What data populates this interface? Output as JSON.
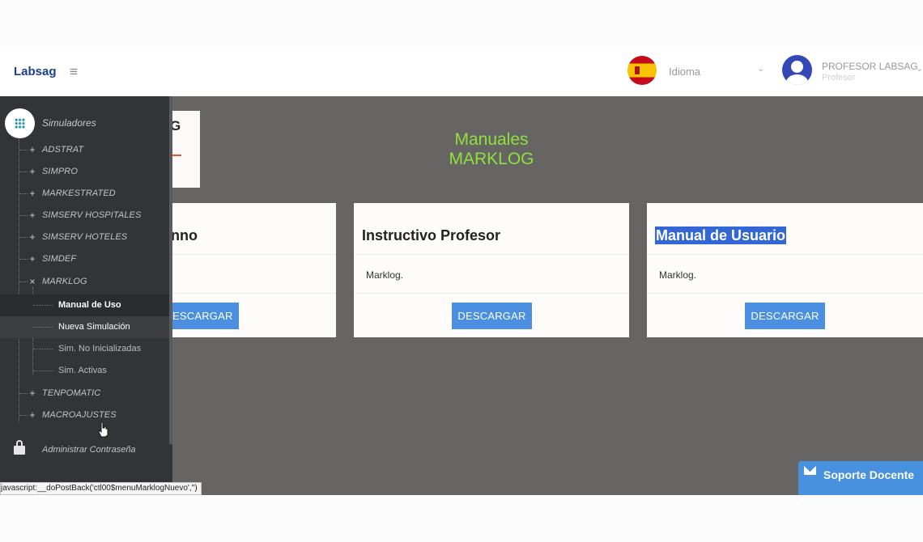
{
  "header": {
    "brand": "Labsag",
    "menu_icon": "hamburger-icon",
    "language_label": "Idioma",
    "user_name": "PROFESOR LABSAG",
    "user_role": "Profesor"
  },
  "sidebar": {
    "root_label": "Simuladores",
    "items": [
      {
        "label": "ADSTRAT",
        "toggle": "+"
      },
      {
        "label": "SIMPRO",
        "toggle": "+"
      },
      {
        "label": "MARKESTRATED",
        "toggle": "+"
      },
      {
        "label": "SIMSERV HOSPITALES",
        "toggle": "+"
      },
      {
        "label": "SIMSERV HOTELES",
        "toggle": "+"
      },
      {
        "label": "SIMDEF",
        "toggle": "+"
      },
      {
        "label": "MARKLOG",
        "toggle": "×"
      },
      {
        "label": "TENPOMATIC",
        "toggle": "+"
      },
      {
        "label": "MACROAJUSTES",
        "toggle": "+"
      }
    ],
    "subitems": [
      {
        "label": "Manual de Uso"
      },
      {
        "label": "Nueva Simulación"
      },
      {
        "label": "Sim. No Inicializadas"
      },
      {
        "label": "Sim. Activas"
      }
    ],
    "password_label": "Administrar Contraseña"
  },
  "main": {
    "logo_text": "G",
    "title_line1": "Manuales",
    "title_line2": "MARKLOG",
    "cards": [
      {
        "title": "nno",
        "text": "",
        "button": "DESCARGAR"
      },
      {
        "title": "Instructivo Profesor",
        "text": "Marklog.",
        "button": "DESCARGAR"
      },
      {
        "title": "Manual de Usuario",
        "text": "Marklog.",
        "button": "DESCARGAR"
      }
    ]
  },
  "status_bar": "javascript:__doPostBack('ctl00$menuMarklogNuevo','')",
  "support": {
    "label": "Soporte Docente"
  },
  "colors": {
    "title_green": "#8ee13b",
    "button_blue": "#4a8fe0",
    "brand_blue": "#1a3f8f",
    "sidebar_bg": "#333438"
  }
}
